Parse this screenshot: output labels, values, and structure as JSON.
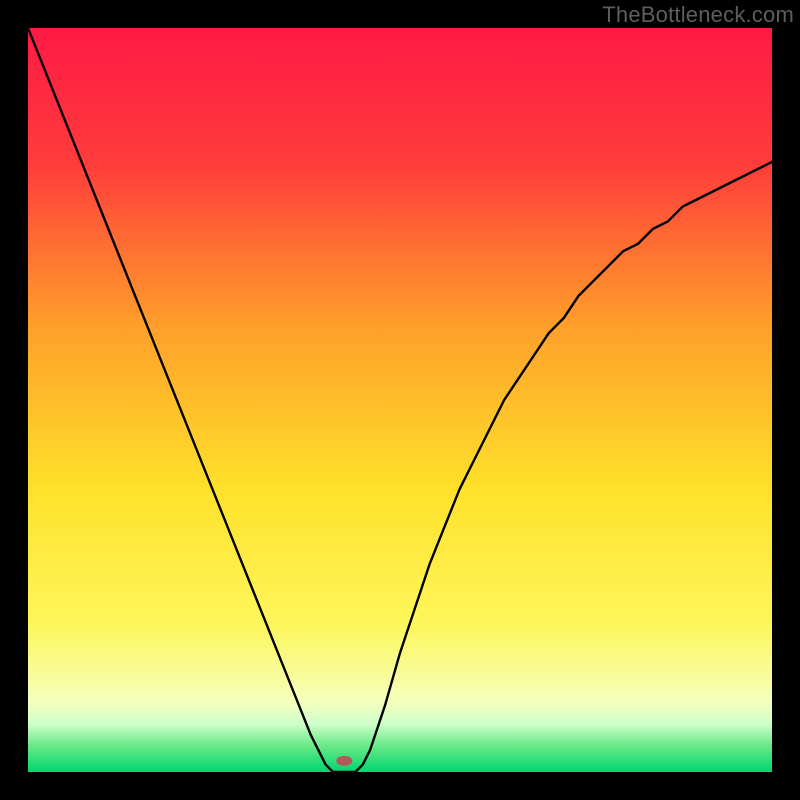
{
  "attribution": "TheBottleneck.com",
  "chart_data": {
    "type": "line",
    "title": "",
    "xlabel": "",
    "ylabel": "",
    "xlim": [
      0,
      1
    ],
    "ylim": [
      0,
      1
    ],
    "x": [
      0.0,
      0.02,
      0.04,
      0.06,
      0.08,
      0.1,
      0.12,
      0.14,
      0.16,
      0.18,
      0.2,
      0.22,
      0.24,
      0.26,
      0.28,
      0.3,
      0.32,
      0.34,
      0.36,
      0.38,
      0.4,
      0.41,
      0.42,
      0.43,
      0.44,
      0.45,
      0.46,
      0.48,
      0.5,
      0.52,
      0.54,
      0.56,
      0.58,
      0.6,
      0.62,
      0.64,
      0.66,
      0.68,
      0.7,
      0.72,
      0.74,
      0.76,
      0.78,
      0.8,
      0.82,
      0.84,
      0.86,
      0.88,
      0.9,
      0.92,
      0.94,
      0.96,
      0.98,
      1.0
    ],
    "values": [
      1.0,
      0.95,
      0.9,
      0.85,
      0.8,
      0.75,
      0.7,
      0.65,
      0.6,
      0.55,
      0.5,
      0.45,
      0.4,
      0.35,
      0.3,
      0.25,
      0.2,
      0.15,
      0.1,
      0.05,
      0.01,
      0.0,
      0.0,
      0.0,
      0.0,
      0.01,
      0.03,
      0.09,
      0.16,
      0.22,
      0.28,
      0.33,
      0.38,
      0.42,
      0.46,
      0.5,
      0.53,
      0.56,
      0.59,
      0.61,
      0.64,
      0.66,
      0.68,
      0.7,
      0.71,
      0.73,
      0.74,
      0.76,
      0.77,
      0.78,
      0.79,
      0.8,
      0.81,
      0.82
    ],
    "marker": {
      "x": 0.425,
      "y": 0.015
    },
    "background_gradient": {
      "stops": [
        {
          "pos": 0.0,
          "color": "#ff1a45"
        },
        {
          "pos": 0.18,
          "color": "#ff3b3b"
        },
        {
          "pos": 0.4,
          "color": "#ff9f2a"
        },
        {
          "pos": 0.62,
          "color": "#ffe12a"
        },
        {
          "pos": 0.8,
          "color": "#fdf65a"
        },
        {
          "pos": 0.905,
          "color": "#f6ffbc"
        },
        {
          "pos": 0.935,
          "color": "#cfffca"
        },
        {
          "pos": 0.965,
          "color": "#69e987"
        },
        {
          "pos": 1.0,
          "color": "#00d66e"
        }
      ]
    }
  }
}
